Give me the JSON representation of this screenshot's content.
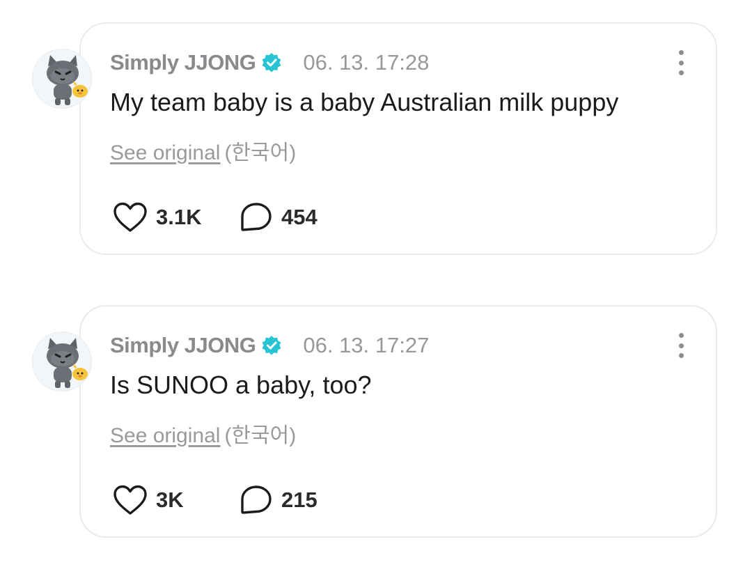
{
  "posts": [
    {
      "author": "Simply JJONG",
      "date": "06. 13. 17:28",
      "text": "My team baby is a baby Australian milk puppy",
      "see_original": "See original",
      "language": "(한국어)",
      "likes": "3.1K",
      "comments": "454"
    },
    {
      "author": "Simply JJONG",
      "date": "06. 13. 17:27",
      "text": "Is SUNOO a baby, too?",
      "see_original": "See original",
      "language": "(한국어)",
      "likes": "3K",
      "comments": "215"
    }
  ],
  "icons": {
    "verified": "verified-badge-icon",
    "like": "heart-icon",
    "comment": "comment-bubble-icon",
    "more": "more-vertical-icon"
  },
  "colors": {
    "verified_badge": "#27c5d3",
    "author_name": "#8a8a8e",
    "body_text": "#1b1b1b",
    "meta_text": "#98989c"
  }
}
